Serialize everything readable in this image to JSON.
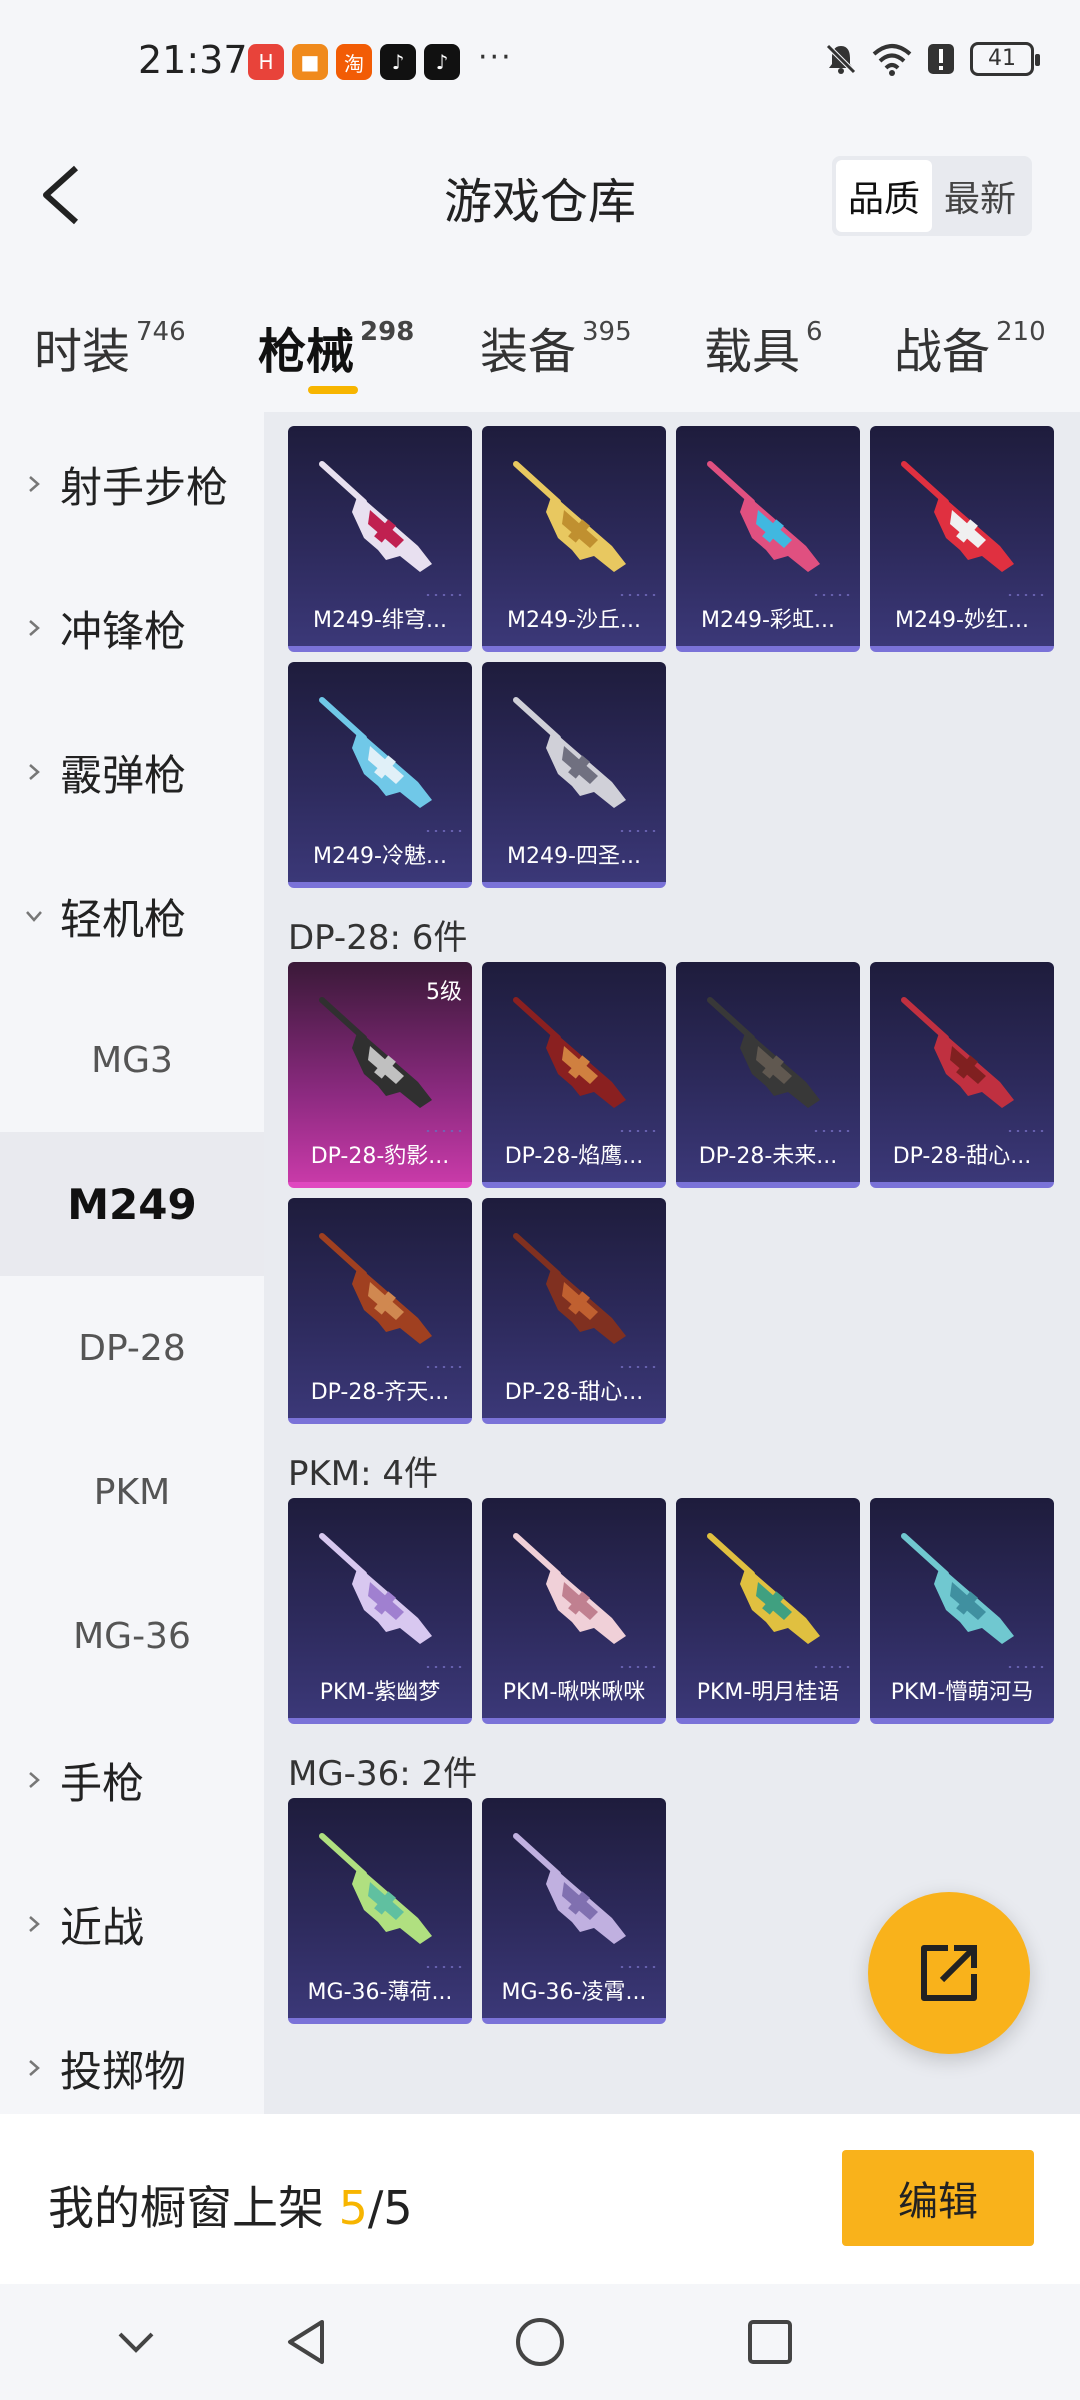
{
  "status_bar": {
    "time": "21:37",
    "apps": [
      {
        "icon": "huawei-app-icon",
        "color": "#e8433a",
        "glyph": "H"
      },
      {
        "icon": "orange-app-icon",
        "color": "#f08a1c",
        "glyph": "■"
      },
      {
        "icon": "taobao-icon",
        "color": "#f25c05",
        "glyph": "淘"
      },
      {
        "icon": "tiktok-icon",
        "color": "#111111",
        "glyph": "♪"
      },
      {
        "icon": "tiktok-icon",
        "color": "#111111",
        "glyph": "♪"
      }
    ],
    "more": "···",
    "battery": "41"
  },
  "header": {
    "title": "游戏仓库",
    "sort_options": [
      "品质",
      "最新"
    ]
  },
  "tabs": [
    {
      "label": "时装",
      "count": "746"
    },
    {
      "label": "枪械",
      "count": "298"
    },
    {
      "label": "装备",
      "count": "395"
    },
    {
      "label": "载具",
      "count": "6"
    },
    {
      "label": "战备",
      "count": "210"
    }
  ],
  "sidebar": {
    "categories": [
      {
        "label": "射手步枪",
        "expanded": false
      },
      {
        "label": "冲锋枪",
        "expanded": false
      },
      {
        "label": "霰弹枪",
        "expanded": false
      },
      {
        "label": "轻机枪",
        "expanded": true
      }
    ],
    "subcategories": [
      "MG3",
      "M249",
      "DP-28",
      "PKM",
      "MG-36"
    ],
    "active_sub": "M249",
    "more_categories": [
      "手枪",
      "近战",
      "投掷物"
    ]
  },
  "groups": [
    {
      "label": "",
      "items": [
        {
          "name": "M249-绯穹...",
          "colors": [
            "#e8e0f0",
            "#c02050"
          ]
        },
        {
          "name": "M249-沙丘...",
          "colors": [
            "#e8c860",
            "#c09030"
          ]
        },
        {
          "name": "M249-彩虹...",
          "colors": [
            "#e05080",
            "#40b8e0"
          ]
        },
        {
          "name": "M249-妙红...",
          "colors": [
            "#e03040",
            "#f0f0f0"
          ]
        },
        {
          "name": "M249-冷魅...",
          "colors": [
            "#70c8e8",
            "#e0f0f8"
          ]
        },
        {
          "name": "M249-四圣...",
          "colors": [
            "#d0d0d8",
            "#707080"
          ]
        }
      ]
    },
    {
      "label": "DP-28: 6件",
      "items": [
        {
          "name": "DP-28-豹影...",
          "colors": [
            "#303030",
            "#c0c0c0"
          ],
          "level": "5级",
          "highlight": true
        },
        {
          "name": "DP-28-焰鹰...",
          "colors": [
            "#8a2020",
            "#d08040"
          ]
        },
        {
          "name": "DP-28-未来...",
          "colors": [
            "#383838",
            "#605850"
          ]
        },
        {
          "name": "DP-28-甜心...",
          "colors": [
            "#c03040",
            "#802020"
          ]
        },
        {
          "name": "DP-28-齐天...",
          "colors": [
            "#a04020",
            "#d08850"
          ]
        },
        {
          "name": "DP-28-甜心...",
          "colors": [
            "#803020",
            "#c06030"
          ]
        }
      ]
    },
    {
      "label": "PKM: 4件",
      "items": [
        {
          "name": "PKM-紫幽梦",
          "colors": [
            "#d8c8f0",
            "#a080d0"
          ]
        },
        {
          "name": "PKM-啾咪啾咪",
          "colors": [
            "#f0d0d8",
            "#c08090"
          ]
        },
        {
          "name": "PKM-明月桂语",
          "colors": [
            "#e0c040",
            "#40a080"
          ]
        },
        {
          "name": "PKM-懵萌河马",
          "colors": [
            "#70c8d0",
            "#4090a0"
          ]
        }
      ]
    },
    {
      "label": "MG-36: 2件",
      "items": [
        {
          "name": "MG-36-薄荷...",
          "colors": [
            "#b0e080",
            "#60c0a0"
          ]
        },
        {
          "name": "MG-36-凌霄...",
          "colors": [
            "#c0b0e0",
            "#8070b0"
          ]
        }
      ]
    }
  ],
  "bottom": {
    "shelf_label": "我的橱窗上架",
    "shelf_count": "5",
    "shelf_total": "/5",
    "edit_label": "编辑"
  },
  "colors": {
    "accent": "#f9b21b",
    "card_border": "#7a72d8",
    "card_highlight": "#e048c0"
  }
}
